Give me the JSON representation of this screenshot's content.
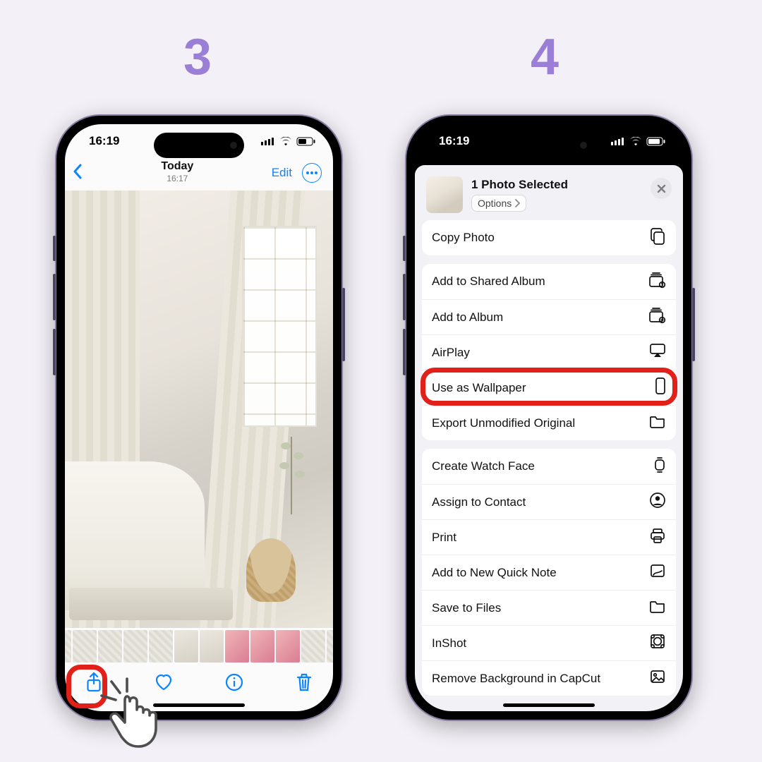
{
  "steps": {
    "left": "3",
    "right": "4"
  },
  "status": {
    "time": "16:19"
  },
  "left": {
    "title": "Today",
    "subtitle": "16:17",
    "edit": "Edit"
  },
  "share": {
    "selected": "1 Photo Selected",
    "options": "Options",
    "groups": [
      [
        "Copy Photo"
      ],
      [
        "Add to Shared Album",
        "Add to Album",
        "AirPlay",
        "Use as Wallpaper",
        "Export Unmodified Original"
      ],
      [
        "Create Watch Face",
        "Assign to Contact",
        "Print",
        "Add to New Quick Note",
        "Save to Files",
        "InShot",
        "Remove Background in CapCut"
      ]
    ],
    "highlight": "Use as Wallpaper"
  }
}
